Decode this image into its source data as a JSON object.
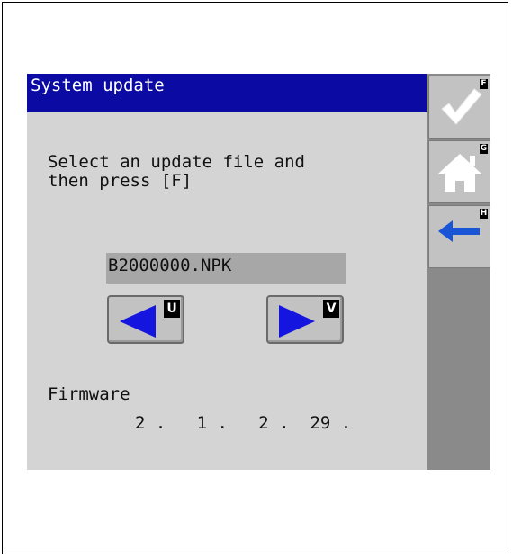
{
  "screen": {
    "title": "System update",
    "instruction": "Select an update file and\nthen press [F]",
    "file_name": "B2000000.NPK",
    "prev_button": {
      "key": "U",
      "icon": "arrow-left-icon"
    },
    "next_button": {
      "key": "V",
      "icon": "arrow-right-icon"
    },
    "firmware_label": "Firmware",
    "firmware_version": "2 .   1 .   2 .  29 ."
  },
  "softkeys": [
    {
      "key": "F",
      "icon": "checkmark-icon"
    },
    {
      "key": "G",
      "icon": "home-icon"
    },
    {
      "key": "H",
      "icon": "back-arrow-icon"
    }
  ],
  "colors": {
    "titlebar": "#0b0ba3",
    "screen_bg": "#d4d4d4",
    "arrow_blue": "#1515e0",
    "back_arrow_blue": "#1a55d6"
  }
}
